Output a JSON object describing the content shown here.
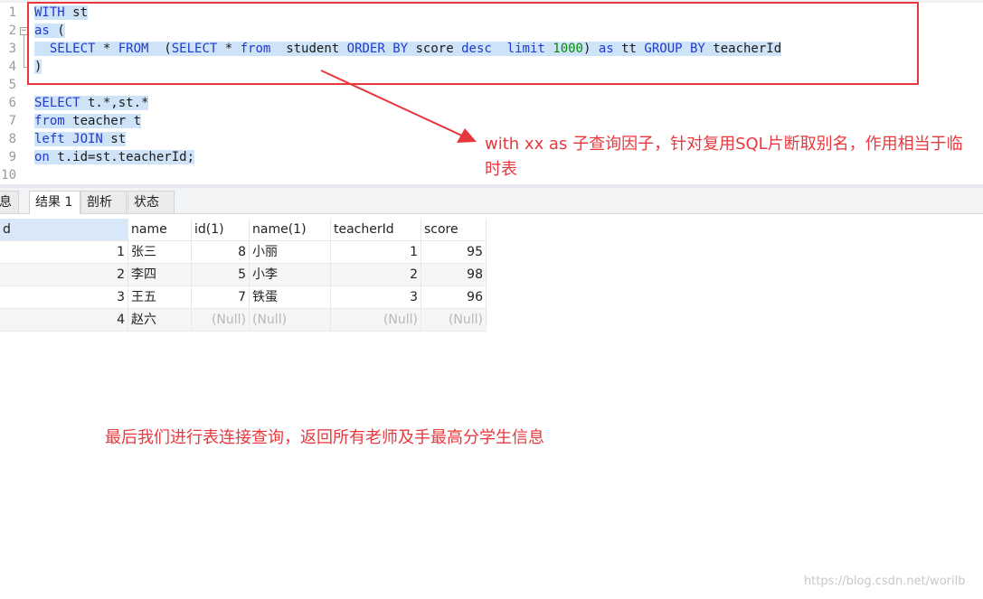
{
  "editor": {
    "line_numbers": [
      "1",
      "2",
      "3",
      "4",
      "5",
      "6",
      "7",
      "8",
      "9",
      "10"
    ],
    "fold_symbol": "−",
    "lines": [
      [
        {
          "t": "WITH",
          "c": "kw"
        },
        {
          "t": " st",
          "c": ""
        }
      ],
      [
        {
          "t": "as",
          "c": "kw"
        },
        {
          "t": " (",
          "c": ""
        }
      ],
      [
        {
          "t": "  ",
          "c": ""
        },
        {
          "t": "SELECT",
          "c": "kw"
        },
        {
          "t": " * ",
          "c": ""
        },
        {
          "t": "FROM",
          "c": "kw"
        },
        {
          "t": "  (",
          "c": ""
        },
        {
          "t": "SELECT",
          "c": "kw"
        },
        {
          "t": " * ",
          "c": ""
        },
        {
          "t": "from",
          "c": "kw"
        },
        {
          "t": "  student ",
          "c": ""
        },
        {
          "t": "ORDER BY",
          "c": "kw"
        },
        {
          "t": " score ",
          "c": ""
        },
        {
          "t": "desc",
          "c": "kw"
        },
        {
          "t": "  ",
          "c": ""
        },
        {
          "t": "limit",
          "c": "kw"
        },
        {
          "t": " ",
          "c": ""
        },
        {
          "t": "1000",
          "c": "num"
        },
        {
          "t": ") ",
          "c": ""
        },
        {
          "t": "as",
          "c": "kw"
        },
        {
          "t": " tt ",
          "c": ""
        },
        {
          "t": "GROUP BY",
          "c": "kw"
        },
        {
          "t": " teacherId",
          "c": ""
        }
      ],
      [
        {
          "t": ")",
          "c": ""
        }
      ],
      [],
      [
        {
          "t": "SELECT",
          "c": "kw"
        },
        {
          "t": " t.*,st.*",
          "c": ""
        }
      ],
      [
        {
          "t": "from",
          "c": "kw"
        },
        {
          "t": " teacher t",
          "c": ""
        }
      ],
      [
        {
          "t": "left JOIN",
          "c": "kw"
        },
        {
          "t": " st",
          "c": ""
        }
      ],
      [
        {
          "t": "on",
          "c": "kw"
        },
        {
          "t": " t.id=st.teacherId;",
          "c": ""
        }
      ],
      []
    ]
  },
  "annotation_top": "with xx as 子查询因子，针对复用SQL片断取别名，作用相当于临时表",
  "annotation_bottom": "最后我们进行表连接查询，返回所有老师及手最高分学生信息",
  "tabs": [
    {
      "label": "息",
      "active": false
    },
    {
      "label": "结果 1",
      "active": true
    },
    {
      "label": "剖析",
      "active": false
    },
    {
      "label": "状态",
      "active": false
    }
  ],
  "result": {
    "columns": [
      "d",
      "name",
      "id(1)",
      "name(1)",
      "teacherId",
      "score"
    ],
    "rows": [
      [
        "1",
        "张三",
        "8",
        "小丽",
        "1",
        "95"
      ],
      [
        "2",
        "李四",
        "5",
        "小李",
        "2",
        "98"
      ],
      [
        "3",
        "王五",
        "7",
        "铁蛋",
        "3",
        "96"
      ],
      [
        "4",
        "赵六",
        "(Null)",
        "(Null)",
        "(Null)",
        "(Null)"
      ]
    ]
  },
  "watermark": "https://blog.csdn.net/worilb",
  "colors": {
    "annotation": "#e8383d",
    "keyword": "#1f3ccc",
    "number": "#0a8a0a",
    "selection": "#cfe3f8"
  }
}
